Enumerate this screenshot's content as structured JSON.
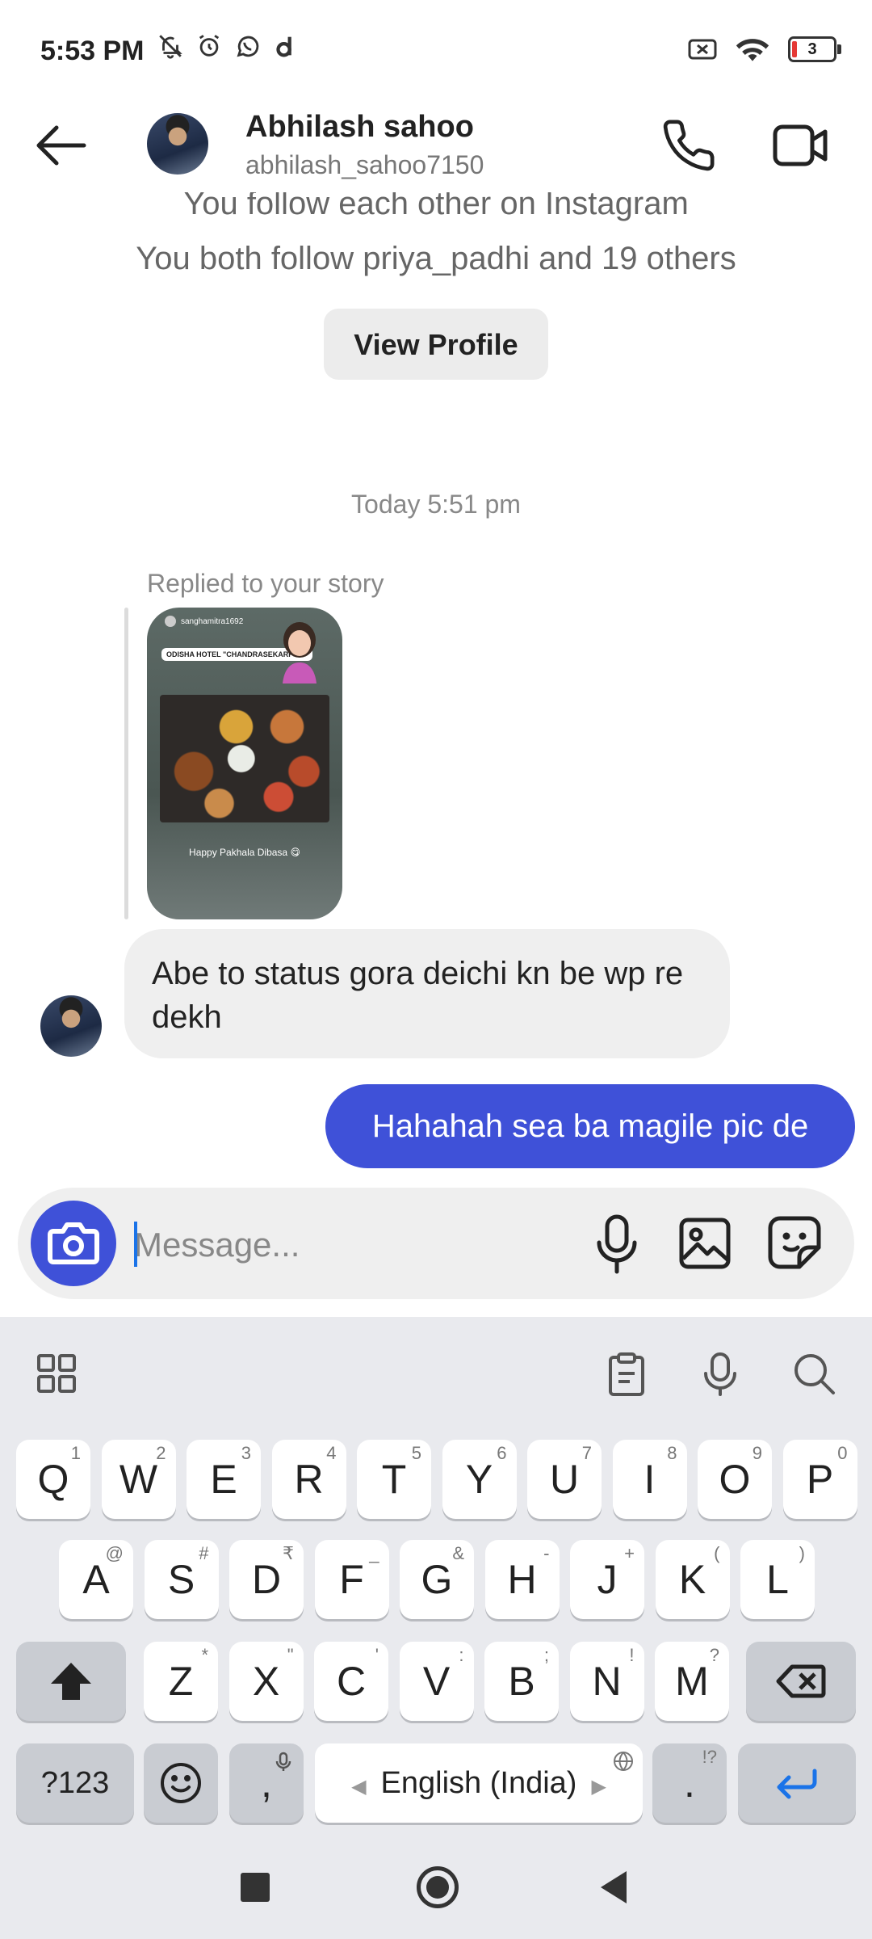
{
  "status_bar": {
    "time": "5:53 PM",
    "battery": "3"
  },
  "header": {
    "name": "Abhilash sahoo",
    "username": "abhilash_sahoo7150"
  },
  "info": {
    "follow_line": "You follow each other on Instagram",
    "mutual_line": "You both follow priya_padhi and 19 others",
    "view_profile_label": "View Profile"
  },
  "thread": {
    "timestamp": "Today 5:51 pm",
    "reply_label": "Replied to your story",
    "story": {
      "username": "sanghamitra1692",
      "location": "ODISHA HOTEL \"CHANDRASEKARPUR\"",
      "caption": "Happy Pakhala Dibasa 😋"
    },
    "messages": [
      {
        "from": "them",
        "text": "Abe to status gora deichi kn be wp re dekh"
      },
      {
        "from": "me",
        "text": "Hahahah sea ba magile pic de"
      }
    ]
  },
  "composer": {
    "placeholder": "Message..."
  },
  "keyboard": {
    "row1": [
      {
        "k": "Q",
        "s": "1"
      },
      {
        "k": "W",
        "s": "2"
      },
      {
        "k": "E",
        "s": "3"
      },
      {
        "k": "R",
        "s": "4"
      },
      {
        "k": "T",
        "s": "5"
      },
      {
        "k": "Y",
        "s": "6"
      },
      {
        "k": "U",
        "s": "7"
      },
      {
        "k": "I",
        "s": "8"
      },
      {
        "k": "O",
        "s": "9"
      },
      {
        "k": "P",
        "s": "0"
      }
    ],
    "row2": [
      {
        "k": "A",
        "s": "@"
      },
      {
        "k": "S",
        "s": "#"
      },
      {
        "k": "D",
        "s": "₹"
      },
      {
        "k": "F",
        "s": "_"
      },
      {
        "k": "G",
        "s": "&"
      },
      {
        "k": "H",
        "s": "-"
      },
      {
        "k": "J",
        "s": "+"
      },
      {
        "k": "K",
        "s": "("
      },
      {
        "k": "L",
        "s": ")"
      }
    ],
    "row3": [
      {
        "k": "Z",
        "s": "*"
      },
      {
        "k": "X",
        "s": "\""
      },
      {
        "k": "C",
        "s": "'"
      },
      {
        "k": "V",
        "s": ":"
      },
      {
        "k": "B",
        "s": ";"
      },
      {
        "k": "N",
        "s": "!"
      },
      {
        "k": "M",
        "s": "?"
      }
    ],
    "symbols_label": "?123",
    "comma": ",",
    "space_label": "English (India)",
    "period": ".",
    "period_sub": "!?"
  },
  "colors": {
    "accent": "#3f51d8",
    "bubble_in": "#efefef",
    "keyboard_bg": "#e9eaee"
  }
}
